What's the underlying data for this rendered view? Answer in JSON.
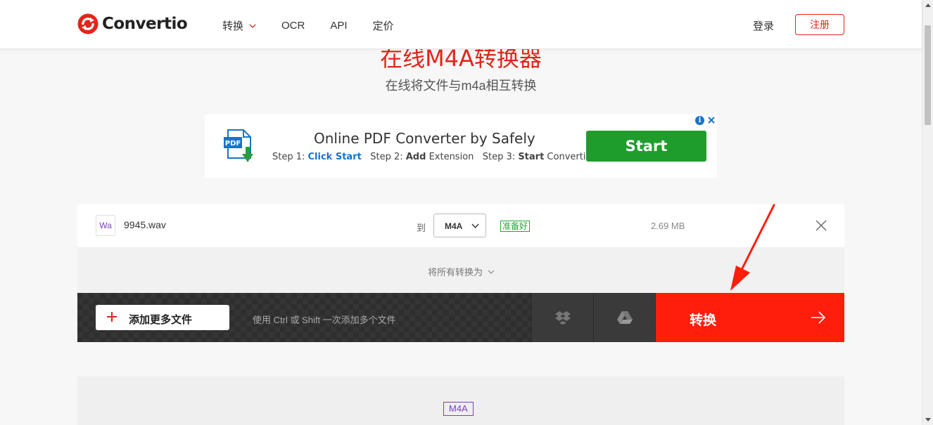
{
  "header": {
    "logo_text": "Convertio",
    "nav": [
      {
        "label": "转换",
        "has_dropdown": true
      },
      {
        "label": "OCR"
      },
      {
        "label": "API"
      },
      {
        "label": "定价"
      }
    ],
    "login": "登录",
    "register": "注册"
  },
  "hero": {
    "title": "在线M4A转换器",
    "subtitle": "在线将文件与m4a相互转换"
  },
  "ad": {
    "title": "Online PDF Converter by Safely",
    "step1_prefix": "Step 1: ",
    "step1_action": "Click Start",
    "step2_prefix": "Step 2: ",
    "step2_action": "Add",
    "step2_suffix": " Extension",
    "step3_prefix": "Step 3: ",
    "step3_action": "Start",
    "step3_suffix": " Converting",
    "button": "Start",
    "icon_label": "PDF"
  },
  "file": {
    "badge": "Wa",
    "name": "9945.wav",
    "to_label": "到",
    "target_format": "M4A",
    "status": "准备好",
    "size": "2.69 MB"
  },
  "convert_all": {
    "label": "将所有转换为"
  },
  "actions": {
    "add_files": "添加更多文件",
    "hint": "使用 Ctrl 或 Shift 一次添加多个文件",
    "convert": "转换"
  },
  "lower": {
    "format_tag": "M4A"
  },
  "colors": {
    "brand_red": "#e1251b",
    "convert_red": "#fe1e0b",
    "ad_green": "#1f9d2c",
    "status_green": "#25a535",
    "format_purple": "#7b3fc2"
  }
}
